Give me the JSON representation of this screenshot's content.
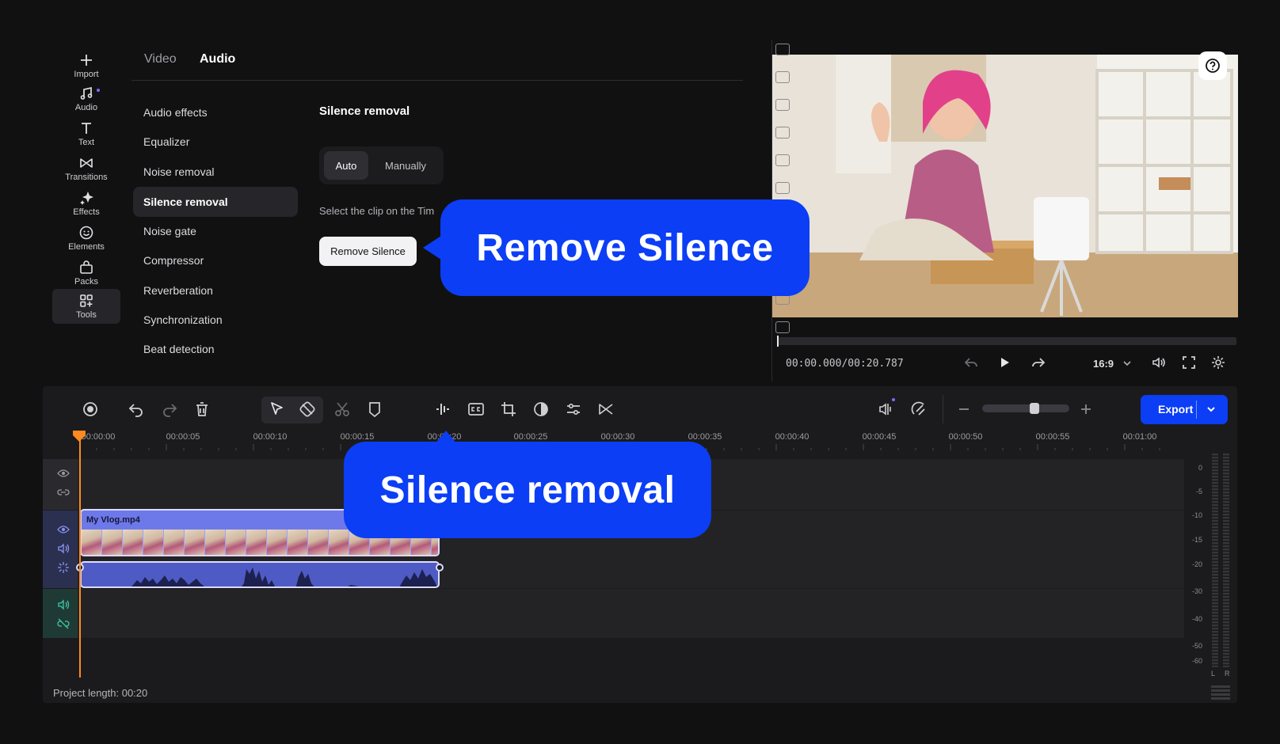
{
  "rail": [
    {
      "label": "Import",
      "icon": "plus-icon"
    },
    {
      "label": "Audio",
      "icon": "music-note-icon"
    },
    {
      "label": "Text",
      "icon": "text-icon"
    },
    {
      "label": "Transitions",
      "icon": "bowtie-icon"
    },
    {
      "label": "Effects",
      "icon": "sparkle-icon"
    },
    {
      "label": "Elements",
      "icon": "smiley-icon"
    },
    {
      "label": "Packs",
      "icon": "bag-icon"
    },
    {
      "label": "Tools",
      "icon": "grid-plus-icon"
    }
  ],
  "tabs": {
    "video": "Video",
    "audio": "Audio"
  },
  "menu": [
    "Audio effects",
    "Equalizer",
    "Noise removal",
    "Silence removal",
    "Noise gate",
    "Compressor",
    "Reverberation",
    "Synchronization",
    "Beat detection"
  ],
  "panel": {
    "title": "Silence removal",
    "mode_auto": "Auto",
    "mode_manual": "Manually",
    "hint": "Select the clip on the Tim",
    "button": "Remove Silence"
  },
  "callouts": {
    "top": "Remove Silence",
    "bottom": "Silence removal"
  },
  "preview": {
    "timecode": "00:00.000/00:20.787",
    "aspect_ratio": "16:9"
  },
  "toolbar": {
    "export": "Export"
  },
  "ruler": [
    "00:00:00",
    "00:00:05",
    "00:00:10",
    "00:00:15",
    "00:00:20",
    "00:00:25",
    "00:00:30",
    "00:00:35",
    "00:00:40",
    "00:00:45",
    "00:00:50",
    "00:00:55",
    "00:01:00"
  ],
  "clip": {
    "name": "My Vlog.mp4"
  },
  "meter": {
    "scale": [
      "0",
      "-5",
      "-10",
      "-15",
      "-20",
      "-30",
      "-40",
      "-50",
      "-60"
    ],
    "left": "L",
    "right": "R"
  },
  "status": "Project length: 00:20",
  "colors": {
    "accent": "#0b3ef5",
    "playhead": "#ff8a1e",
    "clip": "#6d79e8"
  }
}
